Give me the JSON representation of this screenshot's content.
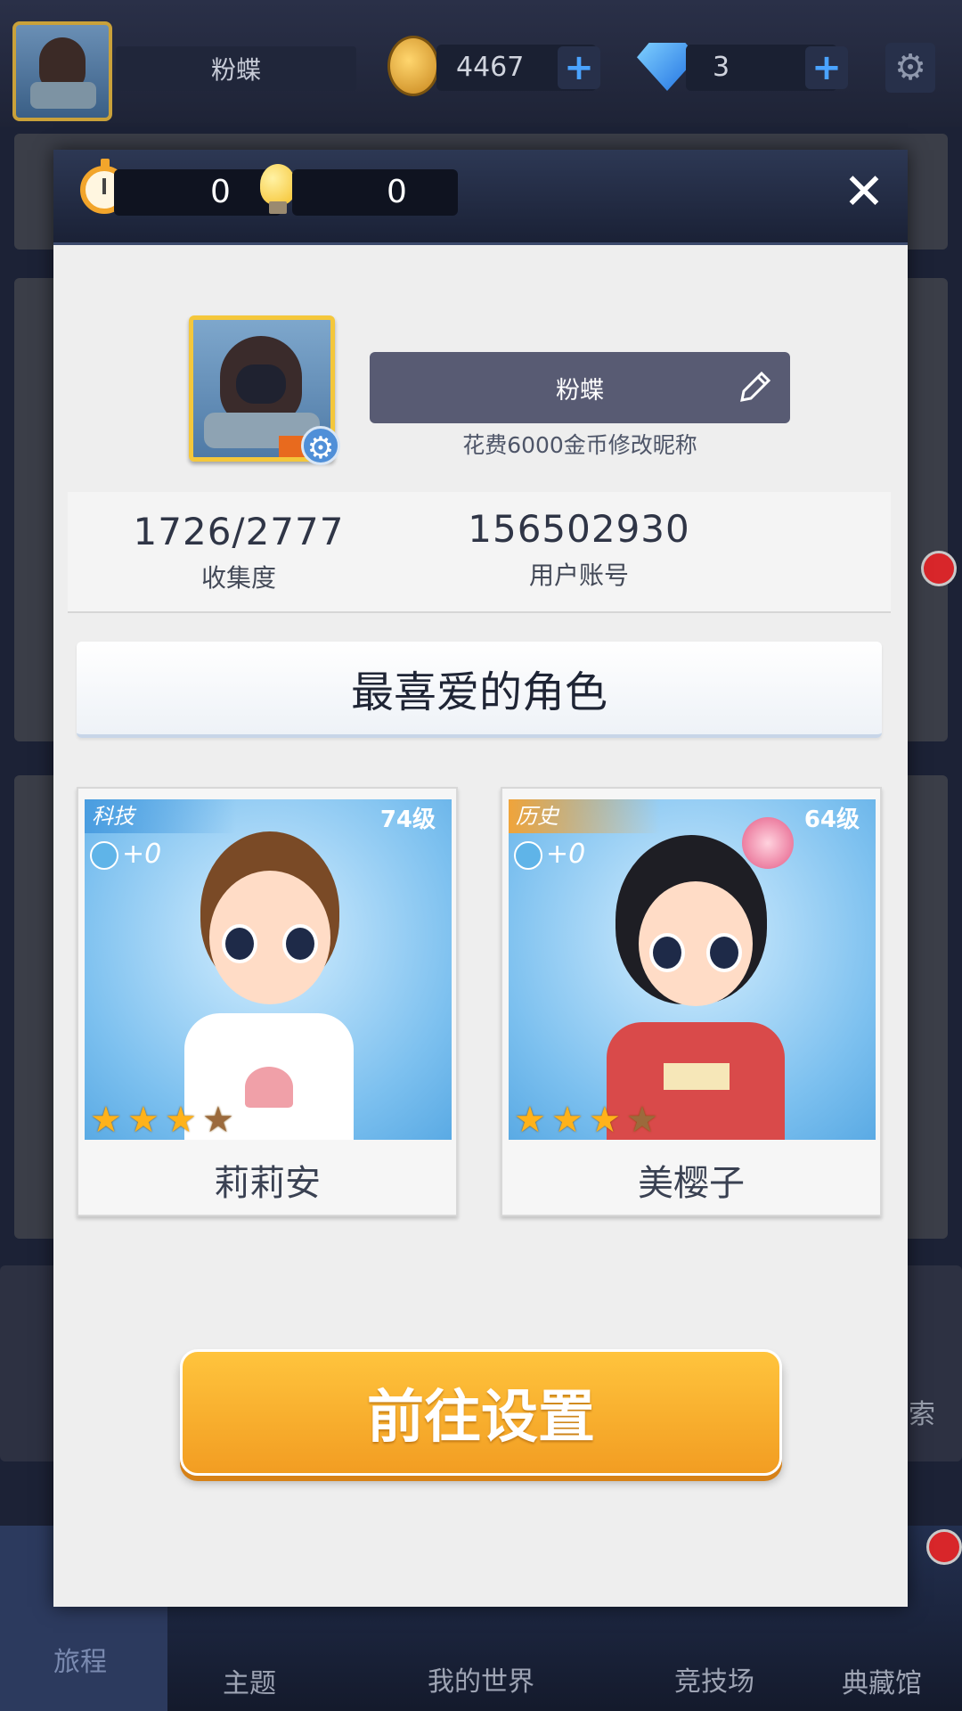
{
  "topbar": {
    "player_name": "粉蝶",
    "coins": "4467",
    "gems": "3",
    "plus_label": "+",
    "gear_glyph": "⚙"
  },
  "bottom_nav": {
    "items": [
      {
        "label": "旅程",
        "active": true
      },
      {
        "label": "主题"
      },
      {
        "label": "我的世界"
      },
      {
        "label": "竞技场"
      },
      {
        "label": "典藏馆"
      }
    ],
    "right_edge_text": "索"
  },
  "modal": {
    "stopwatch_count": "0",
    "hint_count": "0",
    "close_glyph": "✕",
    "nickname": "粉蝶",
    "nickname_hint": "花费6000金币修改昵称",
    "collection_value": "1726/2777",
    "collection_label": "收集度",
    "account_value": "156502930",
    "account_label": "用户账号",
    "favorites_title": "最喜爱的角色",
    "characters": [
      {
        "category": "科技",
        "level": "74级",
        "bonus": "+0",
        "stars": 4,
        "stars_lit": 3,
        "name": "莉莉安",
        "tag_color": "#4a9de0"
      },
      {
        "category": "历史",
        "level": "64级",
        "bonus": "+0",
        "stars": 4,
        "stars_lit": 3,
        "name": "美樱子",
        "tag_color": "#f0a43a"
      }
    ],
    "go_button": "前往设置"
  },
  "colors": {
    "accent_orange": "#f6a82a",
    "nick_box": "#585b73",
    "header_dark": "#1a2136"
  }
}
